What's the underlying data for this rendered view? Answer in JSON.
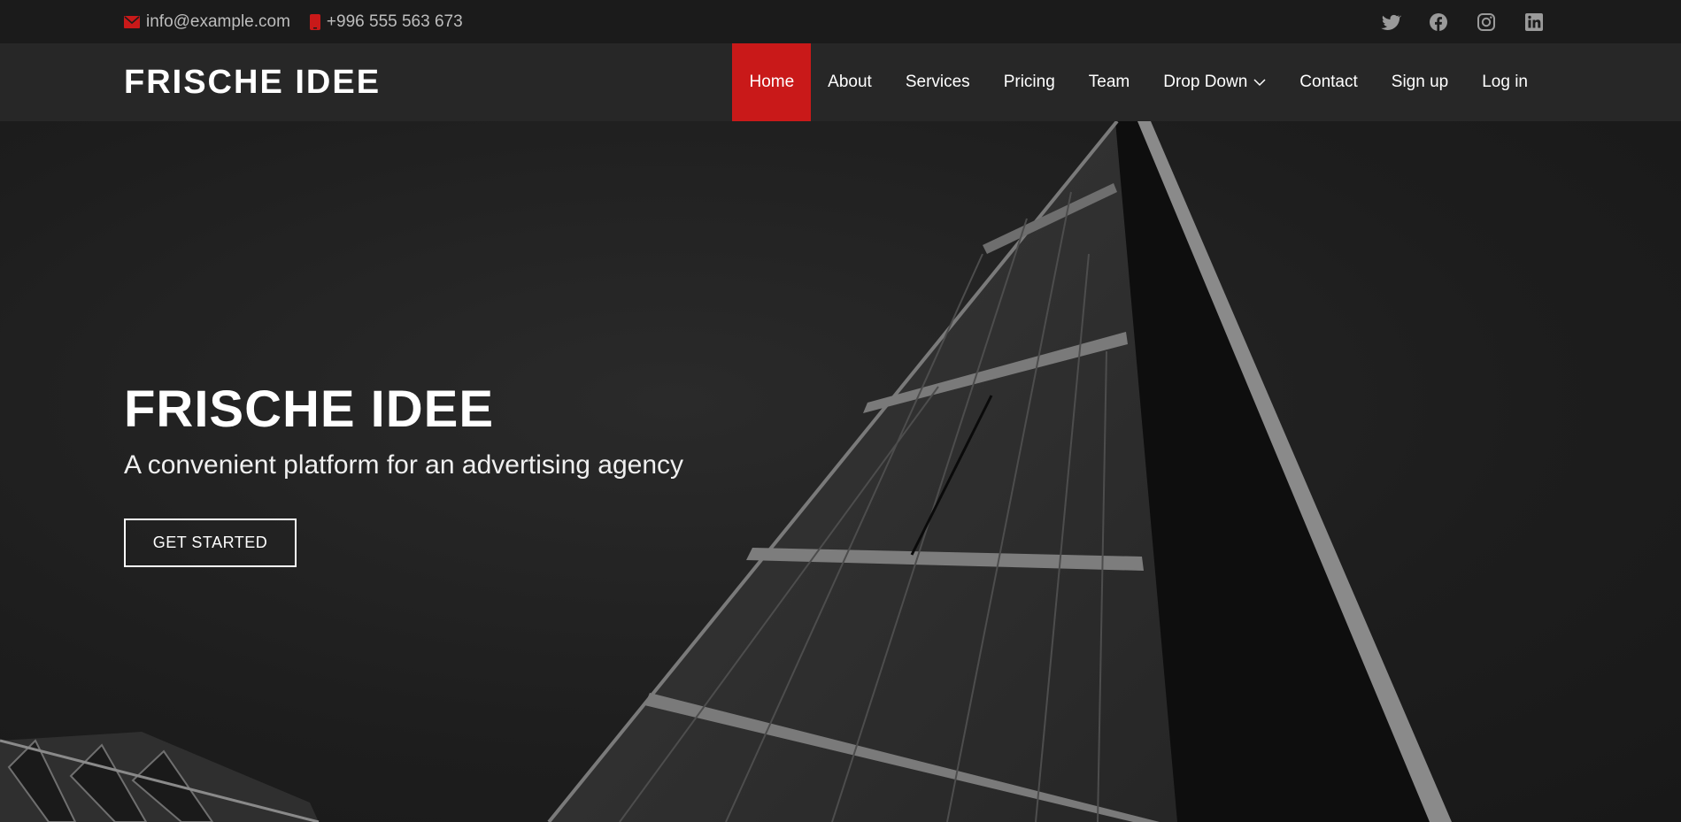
{
  "topbar": {
    "email": "info@example.com",
    "phone": "+996 555 563 673",
    "email_icon": "envelope-icon",
    "phone_icon": "phone-icon",
    "social": [
      "twitter-icon",
      "facebook-icon",
      "instagram-icon",
      "linkedin-icon"
    ]
  },
  "header": {
    "logo": "FRISCHE IDEE",
    "nav": [
      {
        "label": "Home",
        "active": true
      },
      {
        "label": "About"
      },
      {
        "label": "Services"
      },
      {
        "label": "Pricing"
      },
      {
        "label": "Team"
      },
      {
        "label": "Drop Down",
        "dropdown": true
      },
      {
        "label": "Contact"
      },
      {
        "label": "Sign up"
      },
      {
        "label": "Log in"
      }
    ]
  },
  "hero": {
    "title": "FRISCHE IDEE",
    "subtitle": "A convenient platform for an advertising agency",
    "cta": "GET STARTED"
  },
  "colors": {
    "accent": "#c91919",
    "topbar_bg": "#1b1b1b",
    "header_bg": "#272727",
    "muted_text": "#bdbdbd",
    "social_icon": "#9a9a9a"
  }
}
